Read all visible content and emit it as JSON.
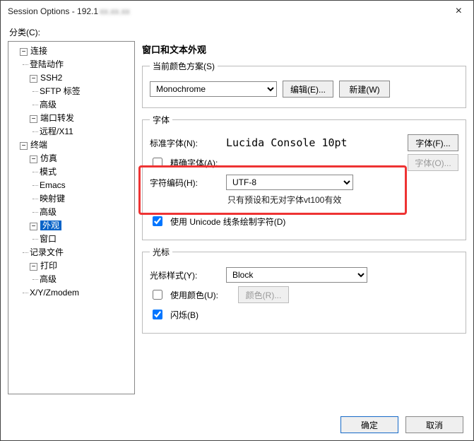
{
  "title_prefix": "Session Options - 192.1",
  "category_label": "分类(C):",
  "close_glyph": "×",
  "tree": {
    "connect": "连接",
    "login_actions": "登陆动作",
    "ssh2": "SSH2",
    "sftp_tab": "SFTP 标签",
    "advanced": "高级",
    "port_forward": "端口转发",
    "remote_x11": "远程/X11",
    "terminal": "终端",
    "emulation": "仿真",
    "mode": "模式",
    "emacs": "Emacs",
    "mapping": "映射键",
    "advanced2": "高级",
    "appearance": "外观",
    "window": "窗口",
    "log_file": "记录文件",
    "print": "打印",
    "advanced3": "高级",
    "xyz": "X/Y/Zmodem"
  },
  "pane_header": "窗口和文本外观",
  "color_scheme": {
    "legend": "当前颜色方案(S)",
    "value": "Monochrome",
    "edit_label": "编辑(E)...",
    "new_label": "新建(W)"
  },
  "fonts": {
    "legend": "字体",
    "normal_label": "标准字体(N):",
    "normal_value": "Lucida Console 10pt",
    "font_btn": "字体(F)...",
    "narrow_chk": "精确字体(A):",
    "font_btn2": "字体(O)...",
    "encoding_label": "字符编码(H):",
    "encoding_value": "UTF-8",
    "encoding_note": "只有预设和无对字体vt100有效",
    "unicode_chk": "使用 Unicode 线条绘制字符(D)"
  },
  "cursor": {
    "legend": "光标",
    "style_label": "光标样式(Y):",
    "style_value": "Block",
    "use_color_label": "使用颜色(U):",
    "color_btn": "颜色(R)...",
    "blink_label": "闪烁(B)"
  },
  "footer": {
    "ok": "确定",
    "cancel": "取消"
  },
  "toggle_minus": "⊟",
  "toggle_minus2": "−"
}
